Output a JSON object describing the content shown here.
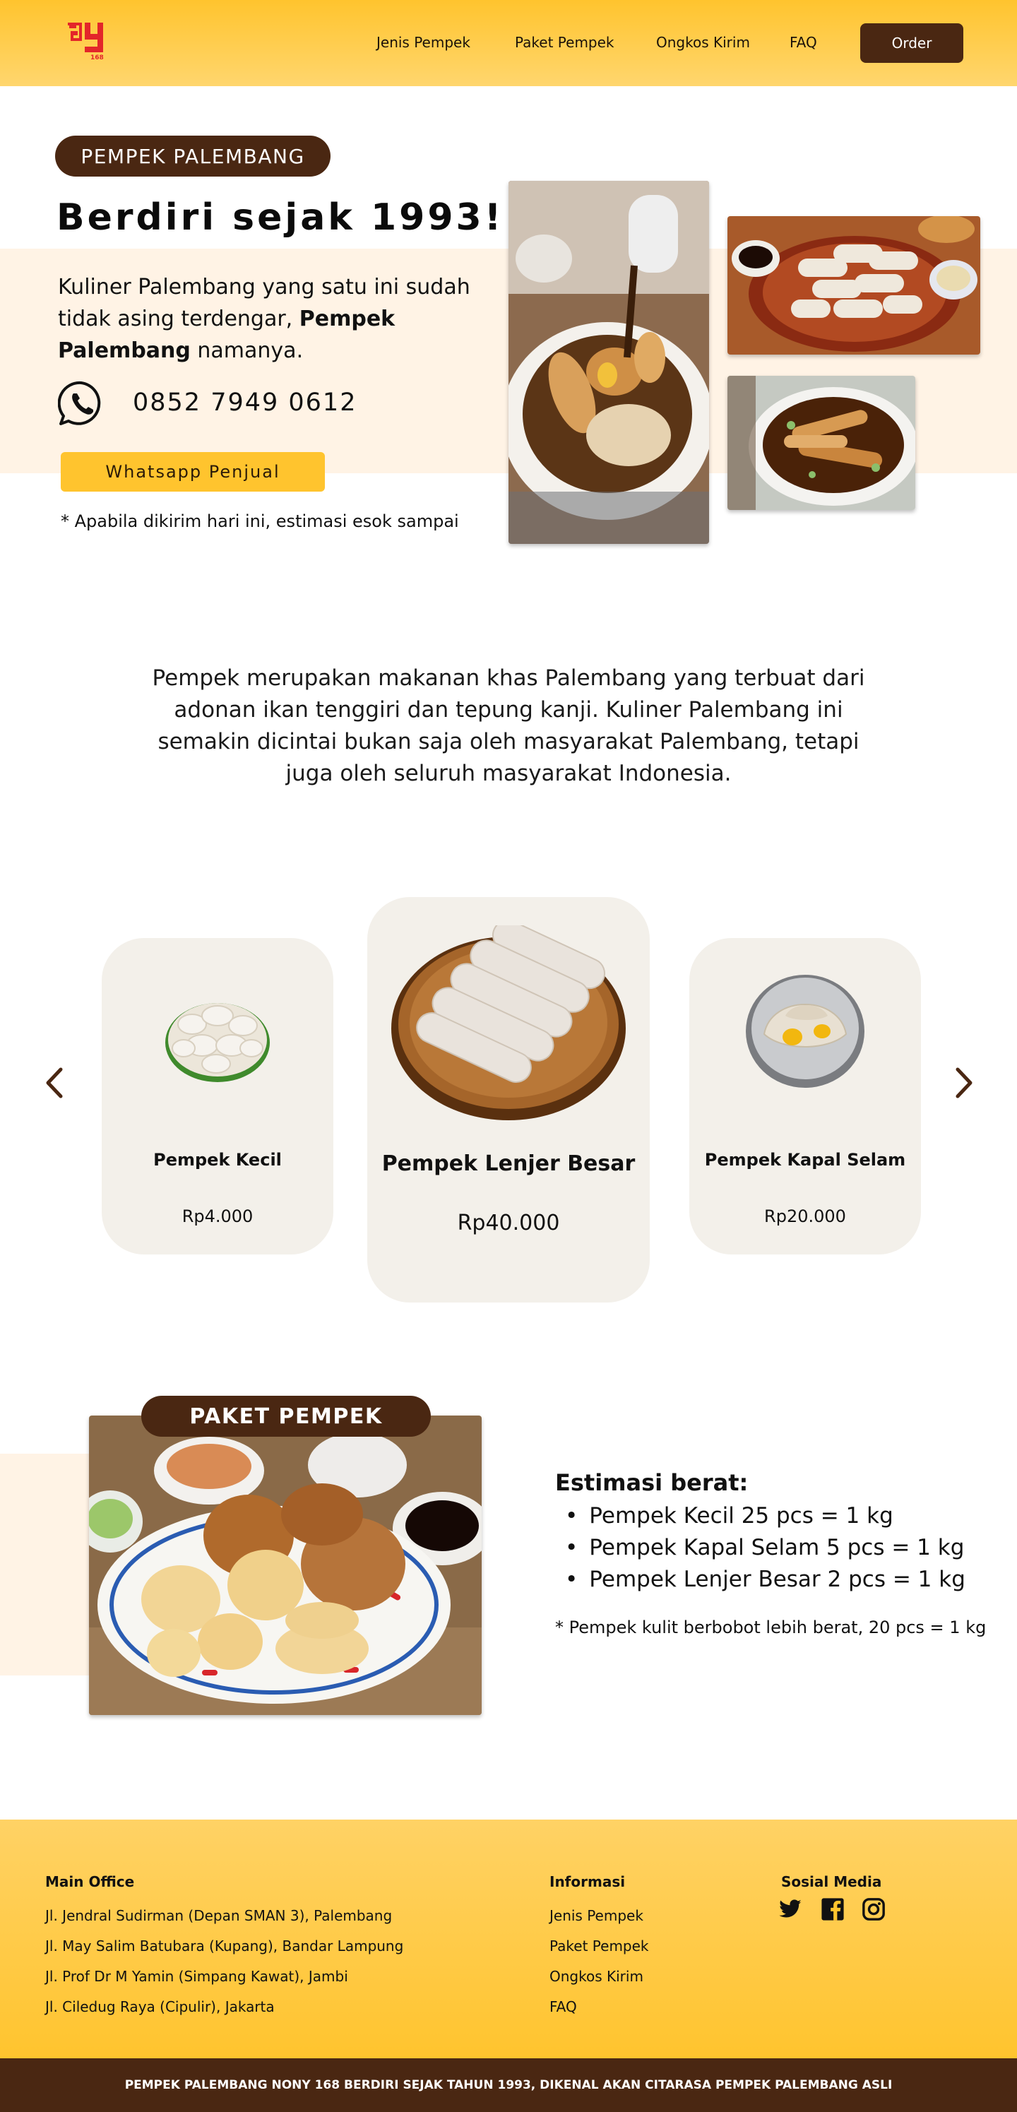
{
  "header": {
    "logo_text": "168",
    "nav": [
      "Jenis Pempek",
      "Paket Pempek",
      "Ongkos Kirim",
      "FAQ"
    ],
    "order_label": "Order"
  },
  "hero": {
    "badge": "PEMPEK PALEMBANG",
    "title": "Berdiri sejak 1993!",
    "desc_start": "Kuliner Palembang yang satu ini sudah tidak asing terdengar, ",
    "desc_bold": "Pempek Palembang",
    "desc_end": " namanya.",
    "phone": "0852 7949 0612",
    "wa_button": "Whatsapp Penjual",
    "note": "* Apabila dikirim hari ini, estimasi esok sampai"
  },
  "intro": "Pempek merupakan makanan khas Palembang yang terbuat dari adonan ikan tenggiri dan tepung kanji. Kuliner Palembang ini semakin dicintai bukan saja oleh masyarakat Palembang, tetapi juga oleh seluruh masyarakat Indonesia.",
  "products": [
    {
      "name": "Pempek Kecil",
      "price": "Rp4.000"
    },
    {
      "name": "Pempek Lenjer Besar",
      "price": "Rp40.000"
    },
    {
      "name": "Pempek Kapal Selam",
      "price": "Rp20.000"
    }
  ],
  "paket": {
    "badge": "PAKET PEMPEK",
    "est_title": "Estimasi berat:",
    "est_items": [
      "Pempek Kecil 25 pcs = 1 kg",
      "Pempek Kapal Selam 5 pcs = 1 kg",
      "Pempek Lenjer Besar 2 pcs = 1 kg"
    ],
    "note": "* Pempek kulit berbobot lebih berat, 20 pcs = 1 kg"
  },
  "footer": {
    "office_title": "Main Office",
    "offices": [
      "Jl. Jendral Sudirman (Depan SMAN 3), Palembang",
      "Jl. May Salim Batubara (Kupang), Bandar Lampung",
      "Jl. Prof Dr M Yamin (Simpang Kawat), Jambi",
      "Jl. Ciledug Raya (Cipulir), Jakarta"
    ],
    "info_title": "Informasi",
    "info_links": [
      "Jenis Pempek",
      "Paket Pempek",
      "Ongkos Kirim",
      "FAQ"
    ],
    "social_title": "Sosial Media",
    "social_icons": [
      "twitter-icon",
      "facebook-icon",
      "instagram-icon"
    ],
    "bottom": "PEMPEK PALEMBANG NONY 168 BERDIRI SEJAK TAHUN 1993, DIKENAL AKAN CITARASA PEMPEK PALEMBANG ASLI"
  },
  "colors": {
    "accent": "#ffc42e",
    "brown": "#4a2712",
    "cream": "#fff3e5",
    "card": "#f3f0ea",
    "logo_red": "#e3262a"
  }
}
